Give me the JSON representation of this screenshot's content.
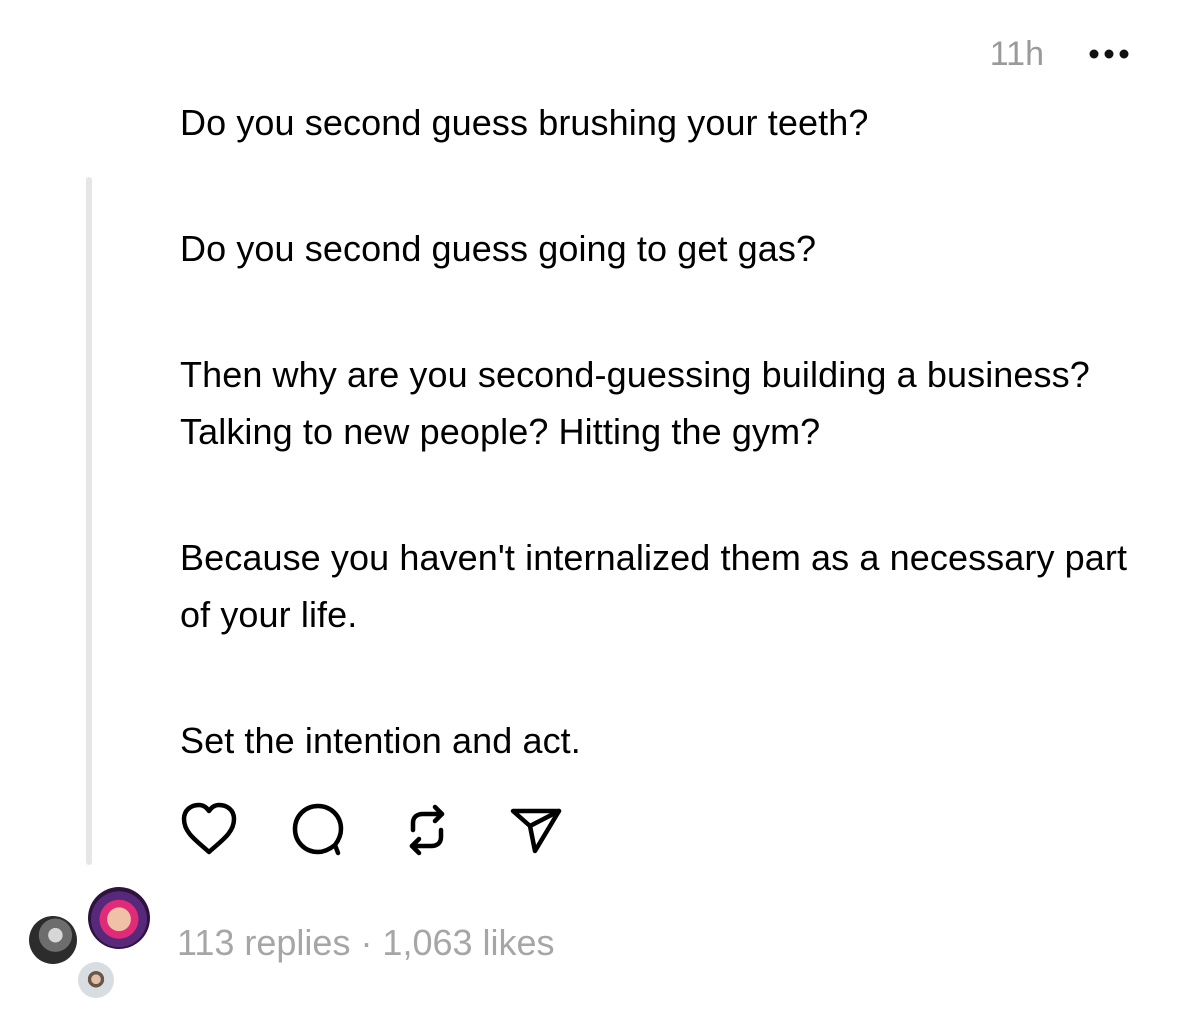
{
  "post": {
    "timestamp": "11h",
    "paragraphs": [
      "Do you second guess brushing your teeth?",
      "Do you second guess going to get gas?",
      "Then why are you second-guessing building a business? Talking to new people? Hitting the gym?",
      "Because you haven't internalized them as a necessary part of your life.",
      "Set the intention and act."
    ],
    "stats": "113 replies · 1,063 likes"
  },
  "icons": {
    "more": "more-icon",
    "like": "heart-icon",
    "reply": "comment-icon",
    "repost": "repost-icon",
    "share": "send-icon"
  },
  "colors": {
    "text": "#000000",
    "muted": "#9a9a9a",
    "thread_line": "#e6e6e6"
  }
}
